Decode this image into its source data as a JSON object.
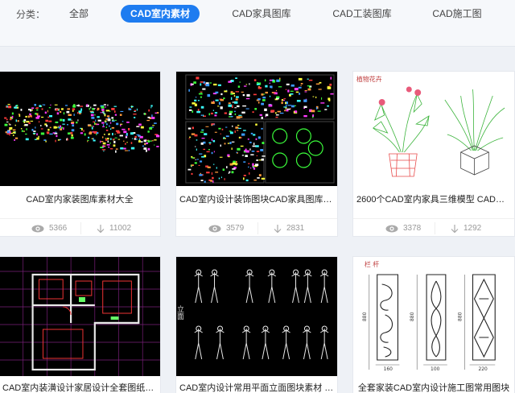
{
  "filter": {
    "label": "分类：",
    "tabs": [
      {
        "label": "全部"
      },
      {
        "label": "CAD室内素材"
      },
      {
        "label": "CAD家具图库"
      },
      {
        "label": "CAD工装图库"
      },
      {
        "label": "CAD施工图"
      }
    ],
    "active_index": 1,
    "accent_color": "#1e7cf0"
  },
  "cards": [
    {
      "title": "CAD室内家装图库素材大全",
      "views": "5366",
      "downloads": "11002"
    },
    {
      "title": "CAD室内设计装饰图块CAD家具图库图块...",
      "views": "3579",
      "downloads": "2831"
    },
    {
      "title": "2600个CAD室内家具三维模型 CAD室内家...",
      "views": "3378",
      "downloads": "1292",
      "thumb_label": "植物花卉"
    },
    {
      "title": "CAD室内装潢设计家居设计全套图纸案例"
    },
    {
      "title": "CAD室内设计常用平面立面图块素材 CAD...",
      "thumb_label": "立面"
    },
    {
      "title": "全套家装CAD室内设计施工图常用图块",
      "thumb_label": "栏 杆",
      "dims": [
        "880",
        "880",
        "880",
        "160",
        "100",
        "220"
      ]
    }
  ],
  "icons": {
    "views": "eye-icon",
    "downloads": "download-arrow-icon"
  }
}
